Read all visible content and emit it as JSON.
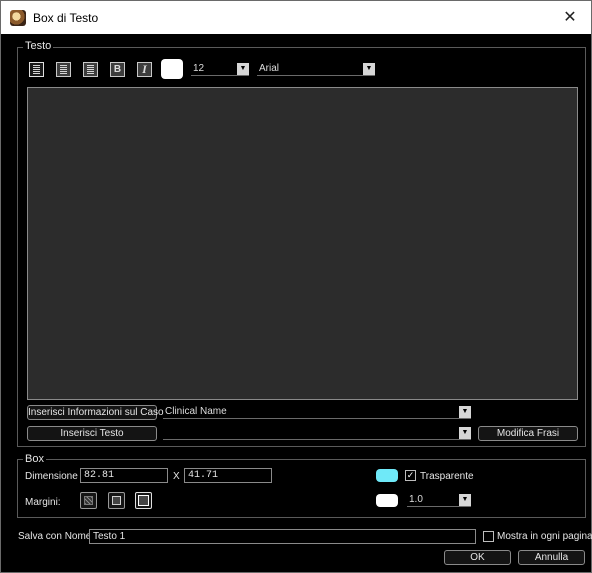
{
  "window": {
    "title": "Box di Testo",
    "close_glyph": "✕"
  },
  "testo": {
    "legend": "Testo",
    "format_buttons": [
      {
        "icon": "align-left-icon"
      },
      {
        "icon": "align-center-icon"
      },
      {
        "icon": "align-right-icon"
      },
      {
        "icon": "bold-icon",
        "label": "B"
      },
      {
        "icon": "italic-icon",
        "label": "I"
      }
    ],
    "text_color": "#ffffff",
    "font_size": "12",
    "font_family": "Arial",
    "content": "",
    "insert_case_info_label": "Inserisci Informazioni sul Caso",
    "case_info_selected": "Clinical Name",
    "insert_text_label": "Inserisci Testo",
    "phrase_selected": "",
    "edit_phrases_label": "Modifica Frasi"
  },
  "box": {
    "legend": "Box",
    "dimension_label": "Dimensione",
    "width": "82.81",
    "x_label": "X",
    "height": "41.71",
    "fill_color": "#6fe9f8",
    "transparent_label": "Trasparente",
    "transparent_checked": true,
    "margins_label": "Margini:",
    "margins_selected": "margin-large",
    "border_color": "#ffffff",
    "border_width": "1.0"
  },
  "save": {
    "label": "Salva con Nome",
    "name": "Testo 1",
    "show_every_page_label": "Mostra in ogni pagina",
    "show_every_page_checked": false
  },
  "footer": {
    "ok_label": "OK",
    "cancel_label": "Annulla"
  }
}
